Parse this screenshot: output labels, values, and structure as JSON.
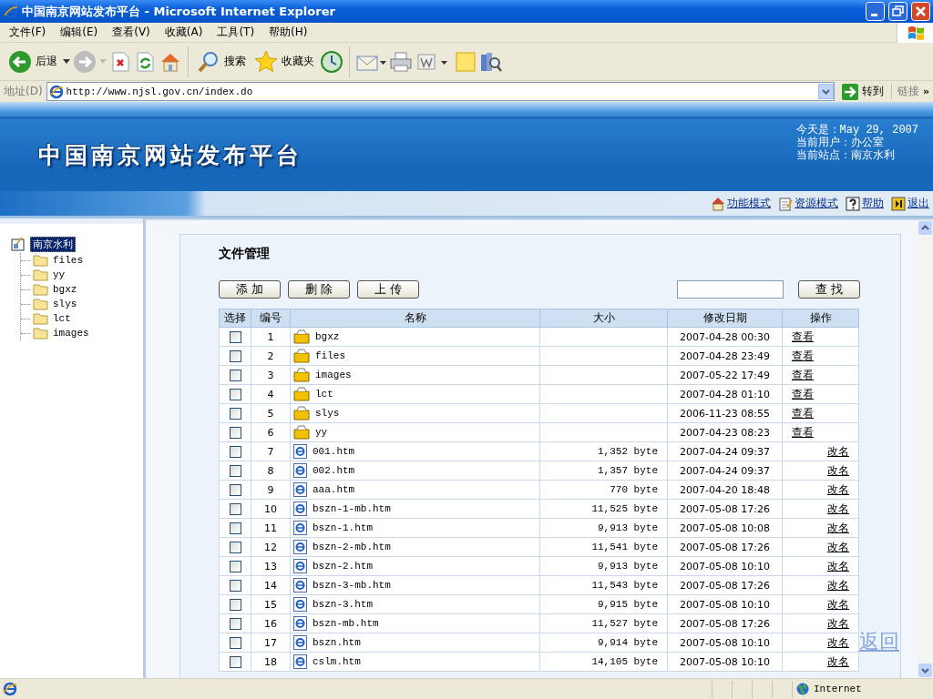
{
  "window": {
    "title": "中国南京网站发布平台 - Microsoft Internet Explorer"
  },
  "menu": [
    "文件(F)",
    "编辑(E)",
    "查看(V)",
    "收藏(A)",
    "工具(T)",
    "帮助(H)"
  ],
  "toolbar": {
    "back": "后退",
    "search": "搜索",
    "favorites": "收藏夹"
  },
  "address": {
    "label": "地址(D)",
    "value": "http://www.njsl.gov.cn/index.do",
    "go": "转到",
    "links": "链接",
    "more": "»"
  },
  "banner": {
    "title": "中国南京网站发布平台",
    "info": [
      "今天是：May 29, 2007",
      "当前用户：办公室",
      "当前站点：南京水利"
    ],
    "links": [
      {
        "kind": "home",
        "label": "功能模式"
      },
      {
        "kind": "note",
        "label": "资源模式"
      },
      {
        "kind": "help",
        "label": "帮助"
      },
      {
        "kind": "exit",
        "label": "退出"
      }
    ]
  },
  "tree": [
    {
      "label": "南京水利",
      "selected": true,
      "children": [
        {
          "label": "files",
          "selected": false
        },
        {
          "label": "yy",
          "selected": false
        },
        {
          "label": "bgxz",
          "selected": false
        },
        {
          "label": "slys",
          "selected": false
        },
        {
          "label": "lct",
          "selected": false
        },
        {
          "label": "images",
          "selected": false
        }
      ]
    }
  ],
  "content": {
    "heading": "文件管理",
    "buttons": [
      "添 加",
      "删 除",
      "上 传"
    ],
    "search_button": "查 找",
    "columns": [
      "选择",
      "编号",
      "名称",
      "大小",
      "修改日期",
      "操作"
    ],
    "rows": [
      {
        "kind": "folder",
        "checked": false,
        "number": "1",
        "name": "bgxz",
        "modified": "2007-04-28 00:30",
        "action": "查看"
      },
      {
        "kind": "folder",
        "checked": false,
        "number": "2",
        "name": "files",
        "modified": "2007-04-28 23:49",
        "action": "查看"
      },
      {
        "kind": "folder",
        "checked": false,
        "number": "3",
        "name": "images",
        "modified": "2007-05-22 17:49",
        "action": "查看"
      },
      {
        "kind": "folder",
        "checked": false,
        "number": "4",
        "name": "lct",
        "modified": "2007-04-28 01:10",
        "action": "查看"
      },
      {
        "kind": "folder",
        "checked": false,
        "number": "5",
        "name": "slys",
        "modified": "2006-11-23 08:55",
        "action": "查看"
      },
      {
        "kind": "folder",
        "checked": false,
        "number": "6",
        "name": "yy",
        "modified": "2007-04-23 08:23",
        "action": "查看"
      },
      {
        "kind": "file",
        "checked": false,
        "number": "7",
        "name": "001.htm",
        "size": "1,352 byte",
        "modified": "2007-04-24 09:37",
        "action": "改名"
      },
      {
        "kind": "file",
        "checked": false,
        "number": "8",
        "name": "002.htm",
        "size": "1,357 byte",
        "modified": "2007-04-24 09:37",
        "action": "改名"
      },
      {
        "kind": "file",
        "checked": false,
        "number": "9",
        "name": "aaa.htm",
        "size": "770 byte",
        "modified": "2007-04-20 18:48",
        "action": "改名"
      },
      {
        "kind": "file",
        "checked": false,
        "number": "10",
        "name": "bszn-1-mb.htm",
        "size": "11,525 byte",
        "modified": "2007-05-08 17:26",
        "action": "改名"
      },
      {
        "kind": "file",
        "checked": false,
        "number": "11",
        "name": "bszn-1.htm",
        "size": "9,913 byte",
        "modified": "2007-05-08 10:08",
        "action": "改名"
      },
      {
        "kind": "file",
        "checked": false,
        "number": "12",
        "name": "bszn-2-mb.htm",
        "size": "11,541 byte",
        "modified": "2007-05-08 17:26",
        "action": "改名"
      },
      {
        "kind": "file",
        "checked": false,
        "number": "13",
        "name": "bszn-2.htm",
        "size": "9,913 byte",
        "modified": "2007-05-08 10:10",
        "action": "改名"
      },
      {
        "kind": "file",
        "checked": false,
        "number": "14",
        "name": "bszn-3-mb.htm",
        "size": "11,543 byte",
        "modified": "2007-05-08 17:26",
        "action": "改名"
      },
      {
        "kind": "file",
        "checked": false,
        "number": "15",
        "name": "bszn-3.htm",
        "size": "9,915 byte",
        "modified": "2007-05-08 10:10",
        "action": "改名"
      },
      {
        "kind": "file",
        "checked": false,
        "number": "16",
        "name": "bszn-mb.htm",
        "size": "11,527 byte",
        "modified": "2007-05-08 17:26",
        "action": "改名"
      },
      {
        "kind": "file",
        "checked": false,
        "number": "17",
        "name": "bszn.htm",
        "size": "9,914 byte",
        "modified": "2007-05-08 10:10",
        "action": "改名"
      },
      {
        "kind": "file",
        "checked": false,
        "number": "18",
        "name": "cslm.htm",
        "size": "14,105 byte",
        "modified": "2007-05-08 10:10",
        "action": "改名"
      }
    ]
  },
  "back_link": "返回",
  "status": {
    "zone": "Internet"
  }
}
